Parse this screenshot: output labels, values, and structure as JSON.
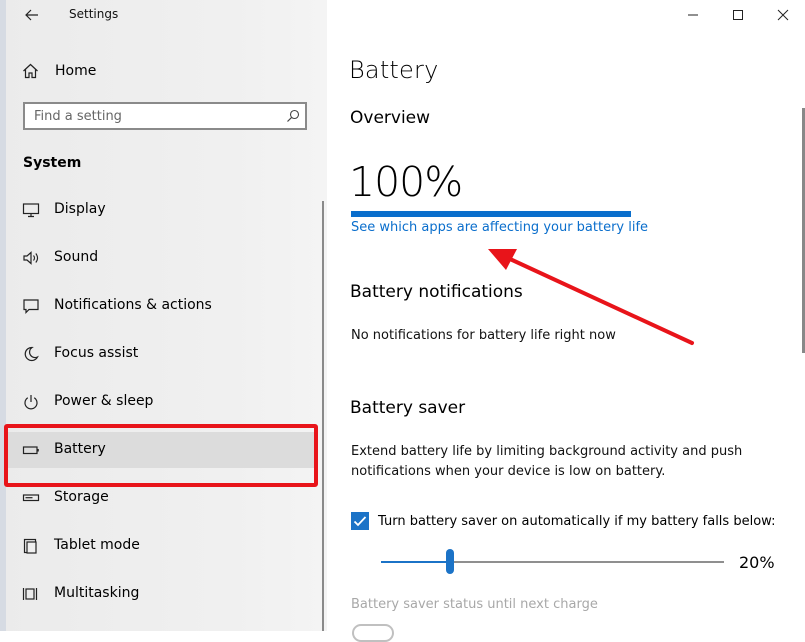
{
  "window": {
    "title": "Settings",
    "controls": {
      "minimize": "minimize",
      "maximize": "maximize",
      "close": "close"
    }
  },
  "sidebar": {
    "home_label": "Home",
    "search": {
      "placeholder": "Find a setting"
    },
    "section_title": "System",
    "items": [
      {
        "label": "Display",
        "icon": "monitor-icon",
        "selected": false
      },
      {
        "label": "Sound",
        "icon": "speaker-icon",
        "selected": false
      },
      {
        "label": "Notifications & actions",
        "icon": "message-icon",
        "selected": false
      },
      {
        "label": "Focus assist",
        "icon": "moon-icon",
        "selected": false
      },
      {
        "label": "Power & sleep",
        "icon": "power-icon",
        "selected": false
      },
      {
        "label": "Battery",
        "icon": "battery-icon",
        "selected": true
      },
      {
        "label": "Storage",
        "icon": "storage-icon",
        "selected": false
      },
      {
        "label": "Tablet mode",
        "icon": "tablet-icon",
        "selected": false
      },
      {
        "label": "Multitasking",
        "icon": "multitasking-icon",
        "selected": false
      }
    ]
  },
  "main": {
    "title": "Battery",
    "overview": {
      "heading": "Overview",
      "percent_text": "100%",
      "level": 1.0,
      "link": "See which apps are affecting your battery life"
    },
    "notifications": {
      "heading": "Battery notifications",
      "text": "No notifications for battery life right now"
    },
    "saver": {
      "heading": "Battery saver",
      "description_line1": "Extend battery life by limiting background activity and push",
      "description_line2": "notifications when your device is low on battery.",
      "checkbox_label": "Turn battery saver on automatically if my battery falls below:",
      "checkbox_checked": true,
      "slider_value_text": "20%",
      "slider_value": 0.2,
      "status_label": "Battery saver status until next charge"
    }
  },
  "colors": {
    "accent": "#0a6ecc",
    "annotation": "#e8141a"
  }
}
